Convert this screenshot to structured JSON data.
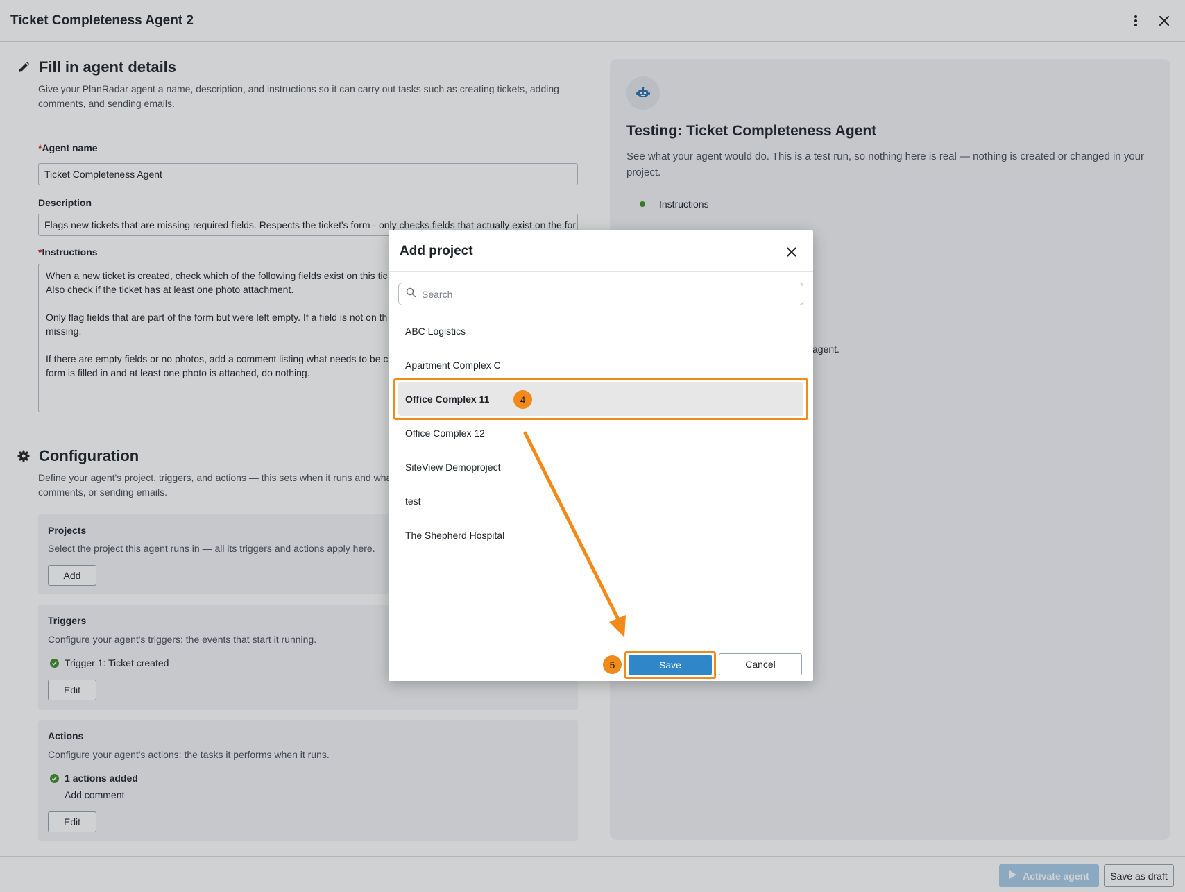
{
  "header": {
    "title": "Ticket Completeness Agent 2"
  },
  "details": {
    "heading": "Fill in agent details",
    "description": "Give your PlanRadar agent a name, description, and instructions so it can carry out tasks such as creating tickets, adding comments, and sending emails.",
    "name_label": "Agent name",
    "name_value": "Ticket Completeness Agent",
    "desc_label": "Description",
    "desc_value": "Flags new tickets that are missing required fields. Respects the ticket's form - only checks fields that actually exist on the for",
    "instructions_label": "Instructions",
    "instructions_value": "When a new ticket is created, check which of the following fields exist on this tic\nAlso check if the ticket has at least one photo attachment.\n\nOnly flag fields that are part of the form but were left empty. If a field is not on th\nmissing.\n\nIf there are empty fields or no photos, add a comment listing what needs to be co\nform is filled in and at least one photo is attached, do nothing."
  },
  "configuration": {
    "heading": "Configuration",
    "description": "Define your agent's project, triggers, and actions — this sets when it runs and what\ncomments, or sending emails.",
    "projects": {
      "title": "Projects",
      "description": "Select the project this agent runs in — all its triggers and actions apply here.",
      "add_label": "Add"
    },
    "triggers": {
      "title": "Triggers",
      "description": "Configure your agent's triggers: the events that start it running.",
      "item": "Trigger 1: Ticket created",
      "edit_label": "Edit"
    },
    "actions": {
      "title": "Actions",
      "description": "Configure your agent's actions: the tasks it performs when it runs.",
      "summary": "1 actions added",
      "item": "Add comment",
      "edit_label": "Edit"
    }
  },
  "test_panel": {
    "title": "Testing: Ticket Completeness Agent",
    "description": "See what your agent would do. This is a test run, so nothing here is real — nothing is created or changed in your project.",
    "timeline_label": "Instructions",
    "fragment": "agent."
  },
  "footer": {
    "activate_label": "Activate agent",
    "draft_label": "Save as draft"
  },
  "modal": {
    "title": "Add project",
    "search_placeholder": "Search",
    "projects": [
      "ABC Logistics",
      "Apartment Complex C",
      "Office Complex 11",
      "Office Complex 12",
      "SiteView Demoproject",
      "test",
      "The Shepherd Hospital"
    ],
    "selected_index": 2,
    "step_select": "4",
    "step_save": "5",
    "save_label": "Save",
    "cancel_label": "Cancel"
  },
  "colors": {
    "accent": "#2f86c8",
    "highlight": "#f28a1a",
    "success": "#3f8f2c"
  }
}
